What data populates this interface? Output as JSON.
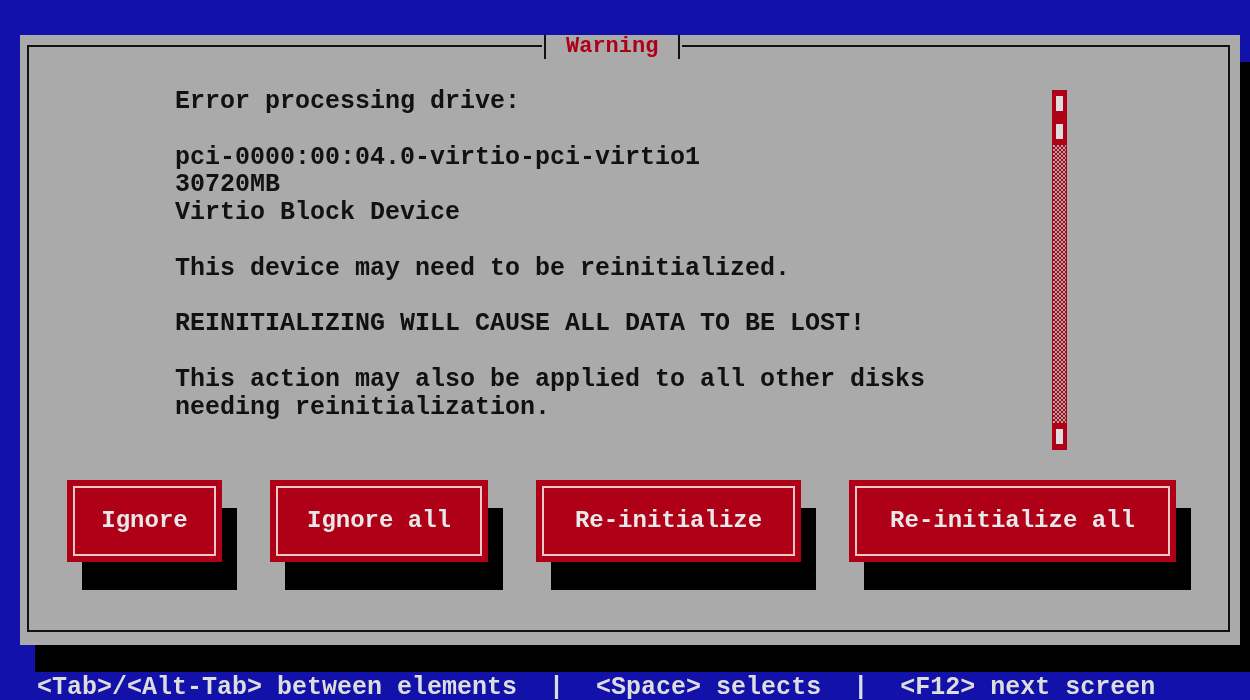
{
  "dialog": {
    "title": "Warning",
    "message": [
      "Error processing drive:",
      "pci-0000:00:04.0-virtio-pci-virtio1\n30720MB\nVirtio Block Device",
      "This device may need to be reinitialized.",
      "REINITIALIZING WILL CAUSE ALL DATA TO BE LOST!",
      "This action may also be applied to all other disks\nneeding reinitialization."
    ],
    "buttons": [
      {
        "label": "Ignore"
      },
      {
        "label": "Ignore all"
      },
      {
        "label": "Re-initialize"
      },
      {
        "label": "Re-initialize all"
      }
    ]
  },
  "status_bar": {
    "hints": [
      "<Tab>/<Alt-Tab> between elements",
      "<Space> selects",
      "<F12> next screen"
    ],
    "separators": [
      "|",
      "|"
    ]
  }
}
